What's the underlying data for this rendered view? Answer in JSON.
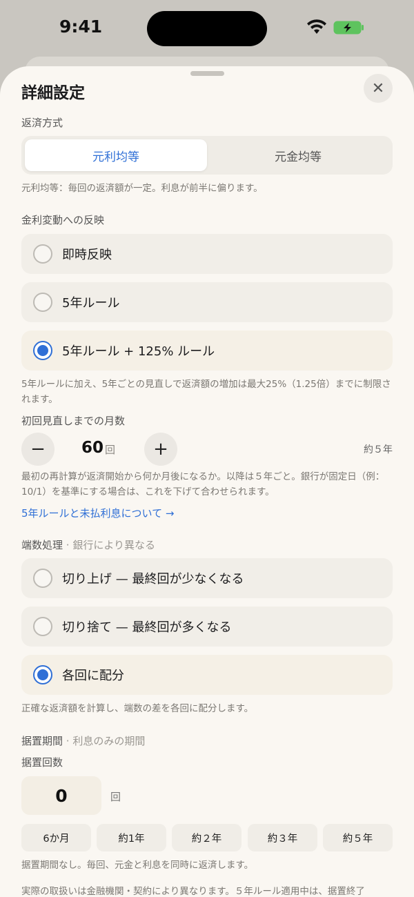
{
  "status": {
    "time": "9:41"
  },
  "sheet": {
    "title": "詳細設定"
  },
  "repayment": {
    "label": "返済方式",
    "options": [
      "元利均等",
      "元金均等"
    ],
    "note": "元利均等：毎回の返済額が一定。利息が前半に偏ります。"
  },
  "rate_change": {
    "label": "金利変動への反映",
    "options": [
      "即時反映",
      "5年ルール",
      "5年ルール + 125% ルール"
    ],
    "note": "5年ルールに加え、5年ごとの見直しで返済額の増加は最大25%（1.25倍）までに制限されます。"
  },
  "first_review": {
    "label": "初回見直しまでの月数",
    "minus": "−",
    "plus": "+",
    "value": "60",
    "unit": "回",
    "approx": "約５年",
    "note": "最初の再計算が返済開始から何か月後になるか。以降は５年ごと。銀行が固定日（例：10/1）を基準にする場合は、これを下げて合わせられます。",
    "link": "5年ルールと未払利息について →"
  },
  "rounding": {
    "label": "端数処理",
    "sublabel": "· 銀行により異なる",
    "options": [
      "切り上げ — 最終回が少なくなる",
      "切り捨て — 最終回が多くなる",
      "各回に配分"
    ],
    "note": "正確な返済額を計算し、端数の差を各回に配分します。"
  },
  "deferral": {
    "label": "据置期間",
    "sublabel": "· 利息のみの期間",
    "count_label": "据置回数",
    "value": "0",
    "unit": "回",
    "presets": [
      "6か月",
      "約1年",
      "約２年",
      "約３年",
      "約５年"
    ],
    "note": "据置期間なし。毎回、元金と利息を同時に返済します。",
    "footer": "実際の取扱いは金融機関・契約により異なります。５年ルール適用中は、据置終了"
  },
  "colors": {
    "accent": "#2f6fd6",
    "background": "#faf7f2"
  }
}
